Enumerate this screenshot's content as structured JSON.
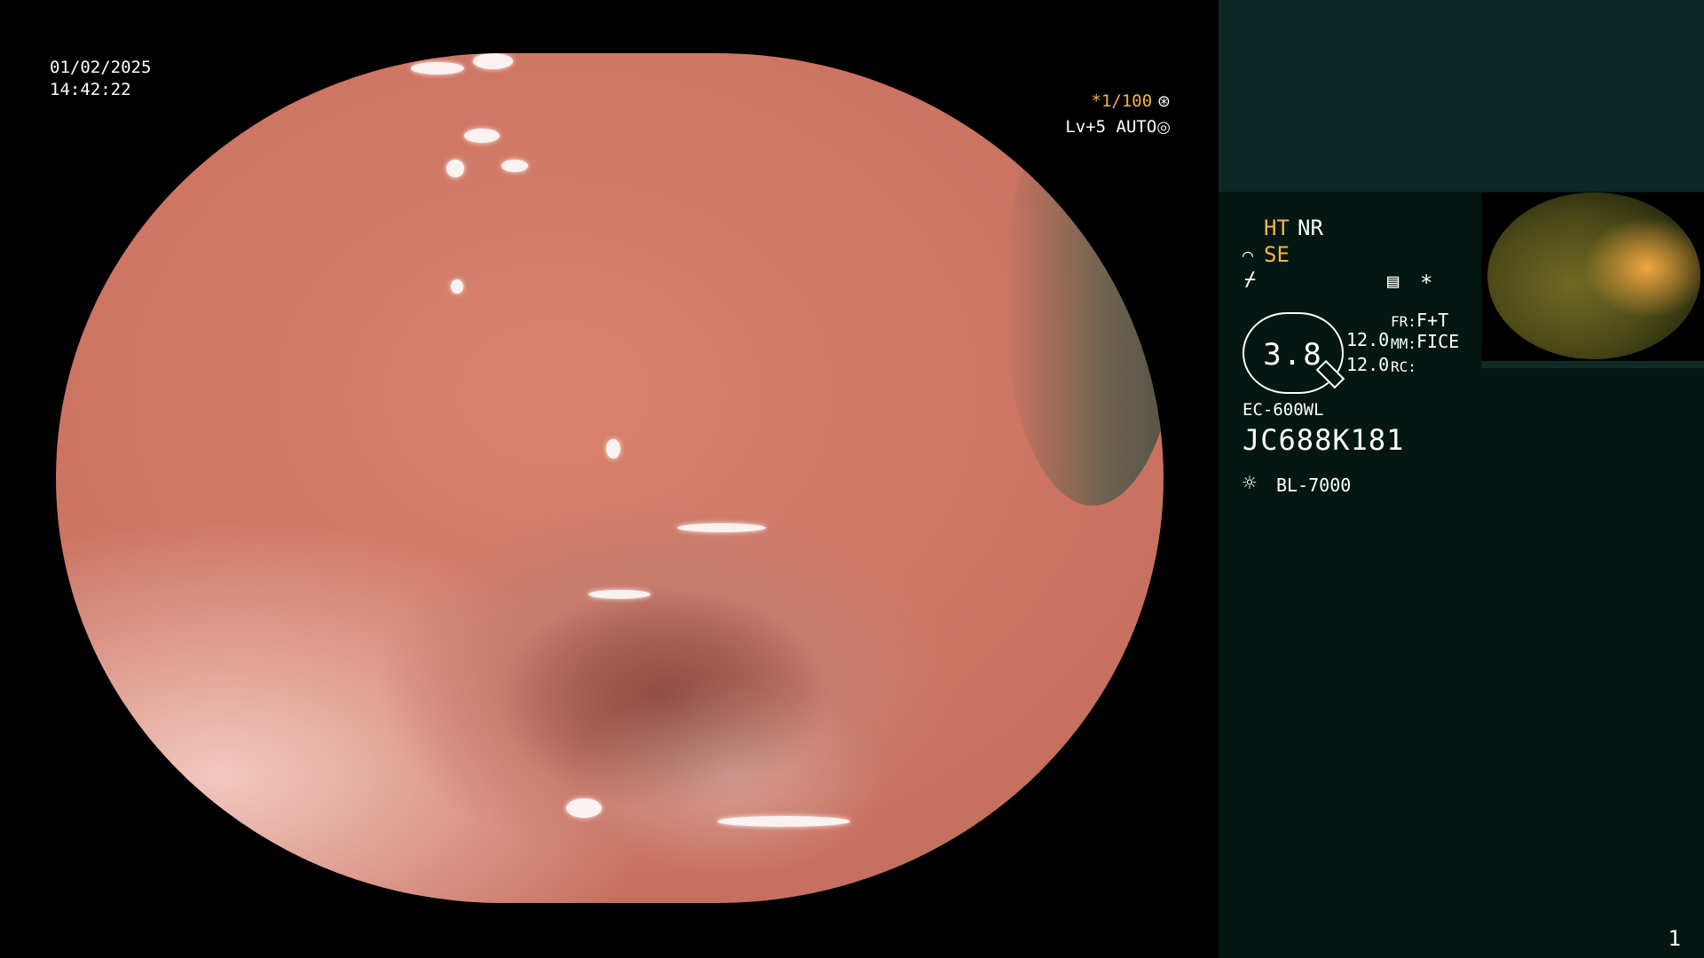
{
  "overlay": {
    "date": "01/02/2025",
    "time": "14:42:22",
    "shutter": "*1/100",
    "level": "Lv+5 AUTO"
  },
  "side": {
    "ht": "HT",
    "nr": "NR",
    "se": "SE",
    "gauge_value": "3.8",
    "fr_value_1": "12.0",
    "fr_value_2": "12.0",
    "fr_label": "FR:",
    "fr_val": "F+T",
    "mm_label": "MM:",
    "mm_val": "FICE",
    "rc_label": "RC:",
    "scope_model": "EC-600WL",
    "scope_serial": "JC688K181",
    "light_source": "BL-7000",
    "page_number": "1"
  },
  "colors": {
    "accent_yellow": "#f2b640",
    "side_background": "#041712",
    "side_top_band": "#0d2724"
  }
}
